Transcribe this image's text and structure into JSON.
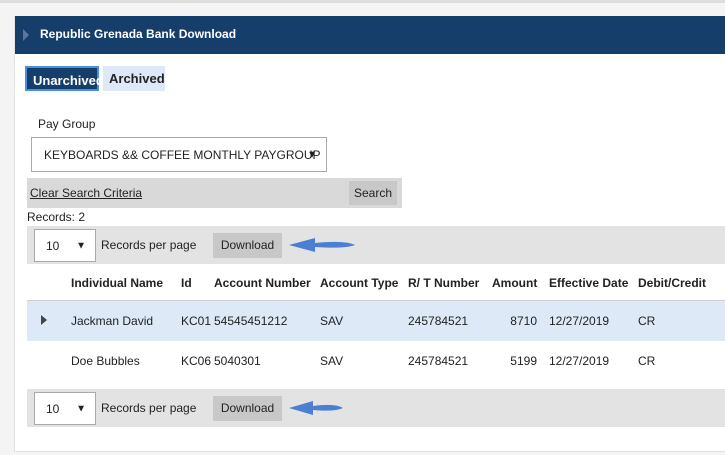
{
  "panel": {
    "title": "Republic Grenada Bank Download"
  },
  "tabs": [
    {
      "label": "Unarchived",
      "active": true
    },
    {
      "label": "Archived",
      "active": false
    }
  ],
  "paygroup": {
    "label": "Pay Group",
    "selected": "KEYBOARDS && COFFEE MONTHLY PAYGROUP"
  },
  "search": {
    "clear_label": "Clear Search Criteria",
    "button_label": "Search"
  },
  "records": {
    "text": "Records:  2"
  },
  "pager": {
    "page_size": "10",
    "per_page_label": "Records per page",
    "download_label": "Download"
  },
  "table": {
    "columns": [
      "Individual Name",
      "Id",
      "Account Number",
      "Account Type",
      "R/ T Number",
      "Amount",
      "Effective Date",
      "Debit/Credit"
    ],
    "rows": [
      {
        "name": "Jackman David",
        "id": "KC01",
        "account_number": "54545451212",
        "account_type": "SAV",
        "rt_number": "245784521",
        "amount": "8710",
        "effective_date": "12/27/2019",
        "debit_credit": "CR",
        "selected": true
      },
      {
        "name": "Doe Bubbles",
        "id": "KC06",
        "account_number": "5040301",
        "account_type": "SAV",
        "rt_number": "245784521",
        "amount": "5199",
        "effective_date": "12/27/2019",
        "debit_credit": "CR",
        "selected": false
      }
    ]
  },
  "colors": {
    "header_bg": "#163e6b",
    "selected_row": "#dde9f7",
    "arrow": "#4a7fd4"
  },
  "icons": [
    "caret-right-icon",
    "dropdown-arrow-icon",
    "row-expander-icon",
    "annotation-arrow-icon"
  ]
}
